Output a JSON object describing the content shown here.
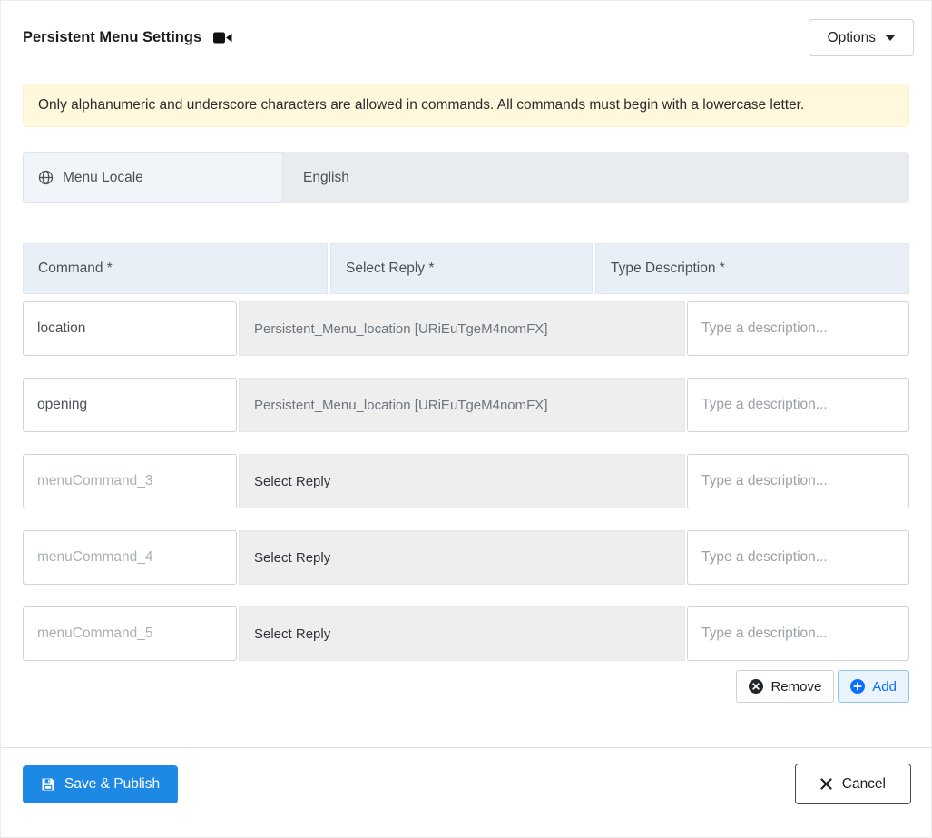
{
  "header": {
    "title": "Persistent Menu Settings",
    "options_button": "Options"
  },
  "alert": {
    "message": "Only alphanumeric and underscore characters are allowed in commands. All commands must begin with a lowercase letter."
  },
  "locale": {
    "label": "Menu Locale",
    "value": "English"
  },
  "table": {
    "headers": [
      "Command *",
      "Select Reply *",
      "Type Description *"
    ],
    "rows": [
      {
        "command": "location",
        "command_placeholder": "",
        "reply": "Persistent_Menu_location [URiEuTgeM4nomFX]",
        "description_placeholder": "Type a description..."
      },
      {
        "command": "opening",
        "command_placeholder": "",
        "reply": "Persistent_Menu_location [URiEuTgeM4nomFX]",
        "description_placeholder": "Type a description..."
      },
      {
        "command": "",
        "command_placeholder": "menuCommand_3",
        "reply": "Select Reply",
        "description_placeholder": "Type a description..."
      },
      {
        "command": "",
        "command_placeholder": "menuCommand_4",
        "reply": "Select Reply",
        "description_placeholder": "Type a description..."
      },
      {
        "command": "",
        "command_placeholder": "menuCommand_5",
        "reply": "Select Reply",
        "description_placeholder": "Type a description..."
      }
    ]
  },
  "row_actions": {
    "remove": "Remove",
    "add": "Add"
  },
  "footer": {
    "save": "Save & Publish",
    "cancel": "Cancel"
  },
  "icons": {
    "title_icon": "video-camera-icon",
    "options_icon": "chevron-down-icon",
    "locale_icon": "globe-icon",
    "remove_icon": "x-circle-icon",
    "add_icon": "plus-circle-icon",
    "save_icon": "floppy-disk-icon",
    "cancel_icon": "x-icon"
  },
  "colors": {
    "primary_blue": "#1e88e5",
    "add_accent": "#0d6efd",
    "alert_background": "#fff8dd",
    "table_header_background": "#e9eff6",
    "disabled_field_background": "#e9ecef"
  }
}
